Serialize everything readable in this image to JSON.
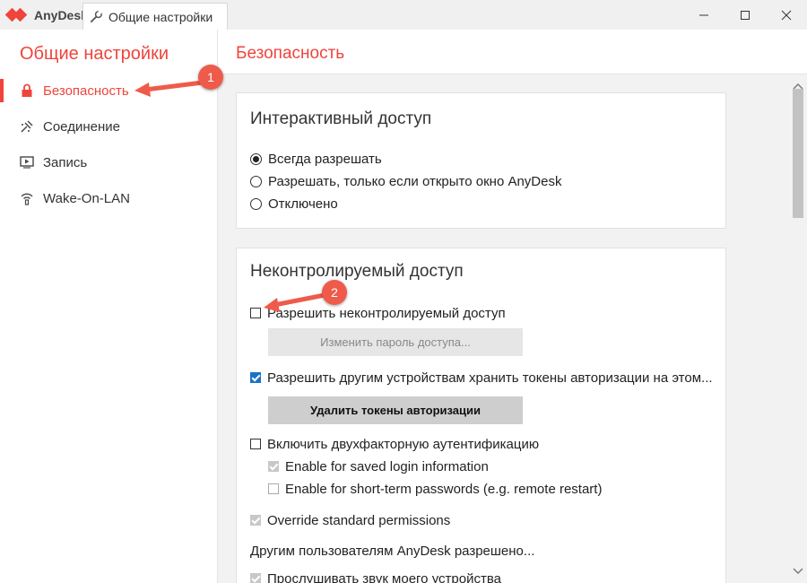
{
  "app": {
    "name": "AnyDesk"
  },
  "tab": {
    "title": "Общие настройки",
    "icon": "wrench-icon"
  },
  "window_controls": {
    "minimize": "minimize-icon",
    "maximize": "maximize-icon",
    "close": "close-icon"
  },
  "sidebar": {
    "title": "Общие настройки",
    "items": [
      {
        "label": "Безопасность",
        "icon": "lock-icon",
        "active": true
      },
      {
        "label": "Соединение",
        "icon": "connection-icon"
      },
      {
        "label": "Запись",
        "icon": "recording-icon"
      },
      {
        "label": "Wake-On-LAN",
        "icon": "wifi-icon"
      }
    ]
  },
  "main": {
    "title": "Безопасность",
    "interactive_access": {
      "title": "Интерактивный доступ",
      "options": [
        {
          "label": "Всегда разрешать",
          "selected": true
        },
        {
          "label": "Разрешать, только если открыто окно AnyDesk",
          "selected": false
        },
        {
          "label": "Отключено",
          "selected": false
        }
      ]
    },
    "unattended_access": {
      "title": "Неконтролируемый доступ",
      "allow_unattended": {
        "label": "Разрешить неконтролируемый доступ",
        "checked": false
      },
      "change_password_button": "Изменить пароль доступа...",
      "allow_tokens": {
        "label": "Разрешить другим устройствам хранить токены авторизации на этом...",
        "checked": true
      },
      "delete_tokens_button": "Удалить токены авторизации",
      "two_factor": {
        "label": "Включить двухфакторную аутентификацию",
        "checked": false
      },
      "saved_login": {
        "label": "Enable for saved login information",
        "checked": true,
        "disabled": true
      },
      "short_term": {
        "label": "Enable for short-term passwords (e.g. remote restart)",
        "checked": false,
        "disabled": true
      },
      "override_permissions": {
        "label": "Override standard permissions",
        "checked": true,
        "disabled": true
      },
      "others_allowed": "Другим пользователям AnyDesk разрешено...",
      "listen_sound": {
        "label": "Прослушивать звук моего устройства",
        "checked": true,
        "disabled": true
      }
    }
  },
  "annotations": {
    "badge1": "1",
    "badge2": "2"
  },
  "colors": {
    "accent": "#ef443b",
    "checkbox_blue": "#1a73c8",
    "badge": "#ef5b4a"
  }
}
